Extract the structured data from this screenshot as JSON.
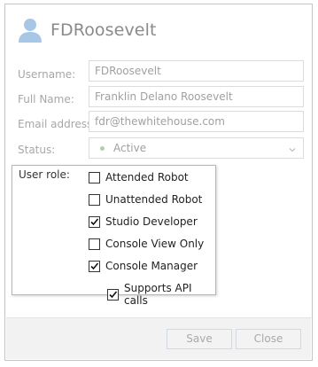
{
  "header": {
    "title": "FDRoosevelt",
    "icon": "user-avatar-icon",
    "icon_color": "#a7c7e7"
  },
  "form": {
    "username": {
      "label": "Username:",
      "value": "FDRoosevelt"
    },
    "full_name": {
      "label": "Full Name:",
      "value": "Franklin Delano Roosevelt"
    },
    "email": {
      "label": "Email address:",
      "value": "fdr@thewhitehouse.com"
    },
    "status": {
      "label": "Status:",
      "value": "Active",
      "indicator_color": "#a8d4a8"
    }
  },
  "user_role": {
    "label": "User role:",
    "options": [
      {
        "label": "Attended Robot",
        "checked": false
      },
      {
        "label": "Unattended Robot",
        "checked": false
      },
      {
        "label": "Studio Developer",
        "checked": true
      },
      {
        "label": "Console View Only",
        "checked": false
      },
      {
        "label": "Console Manager",
        "checked": true
      },
      {
        "label": "Supports API calls",
        "checked": true,
        "indented": true
      }
    ]
  },
  "footer": {
    "save_label": "Save",
    "close_label": "Close"
  }
}
